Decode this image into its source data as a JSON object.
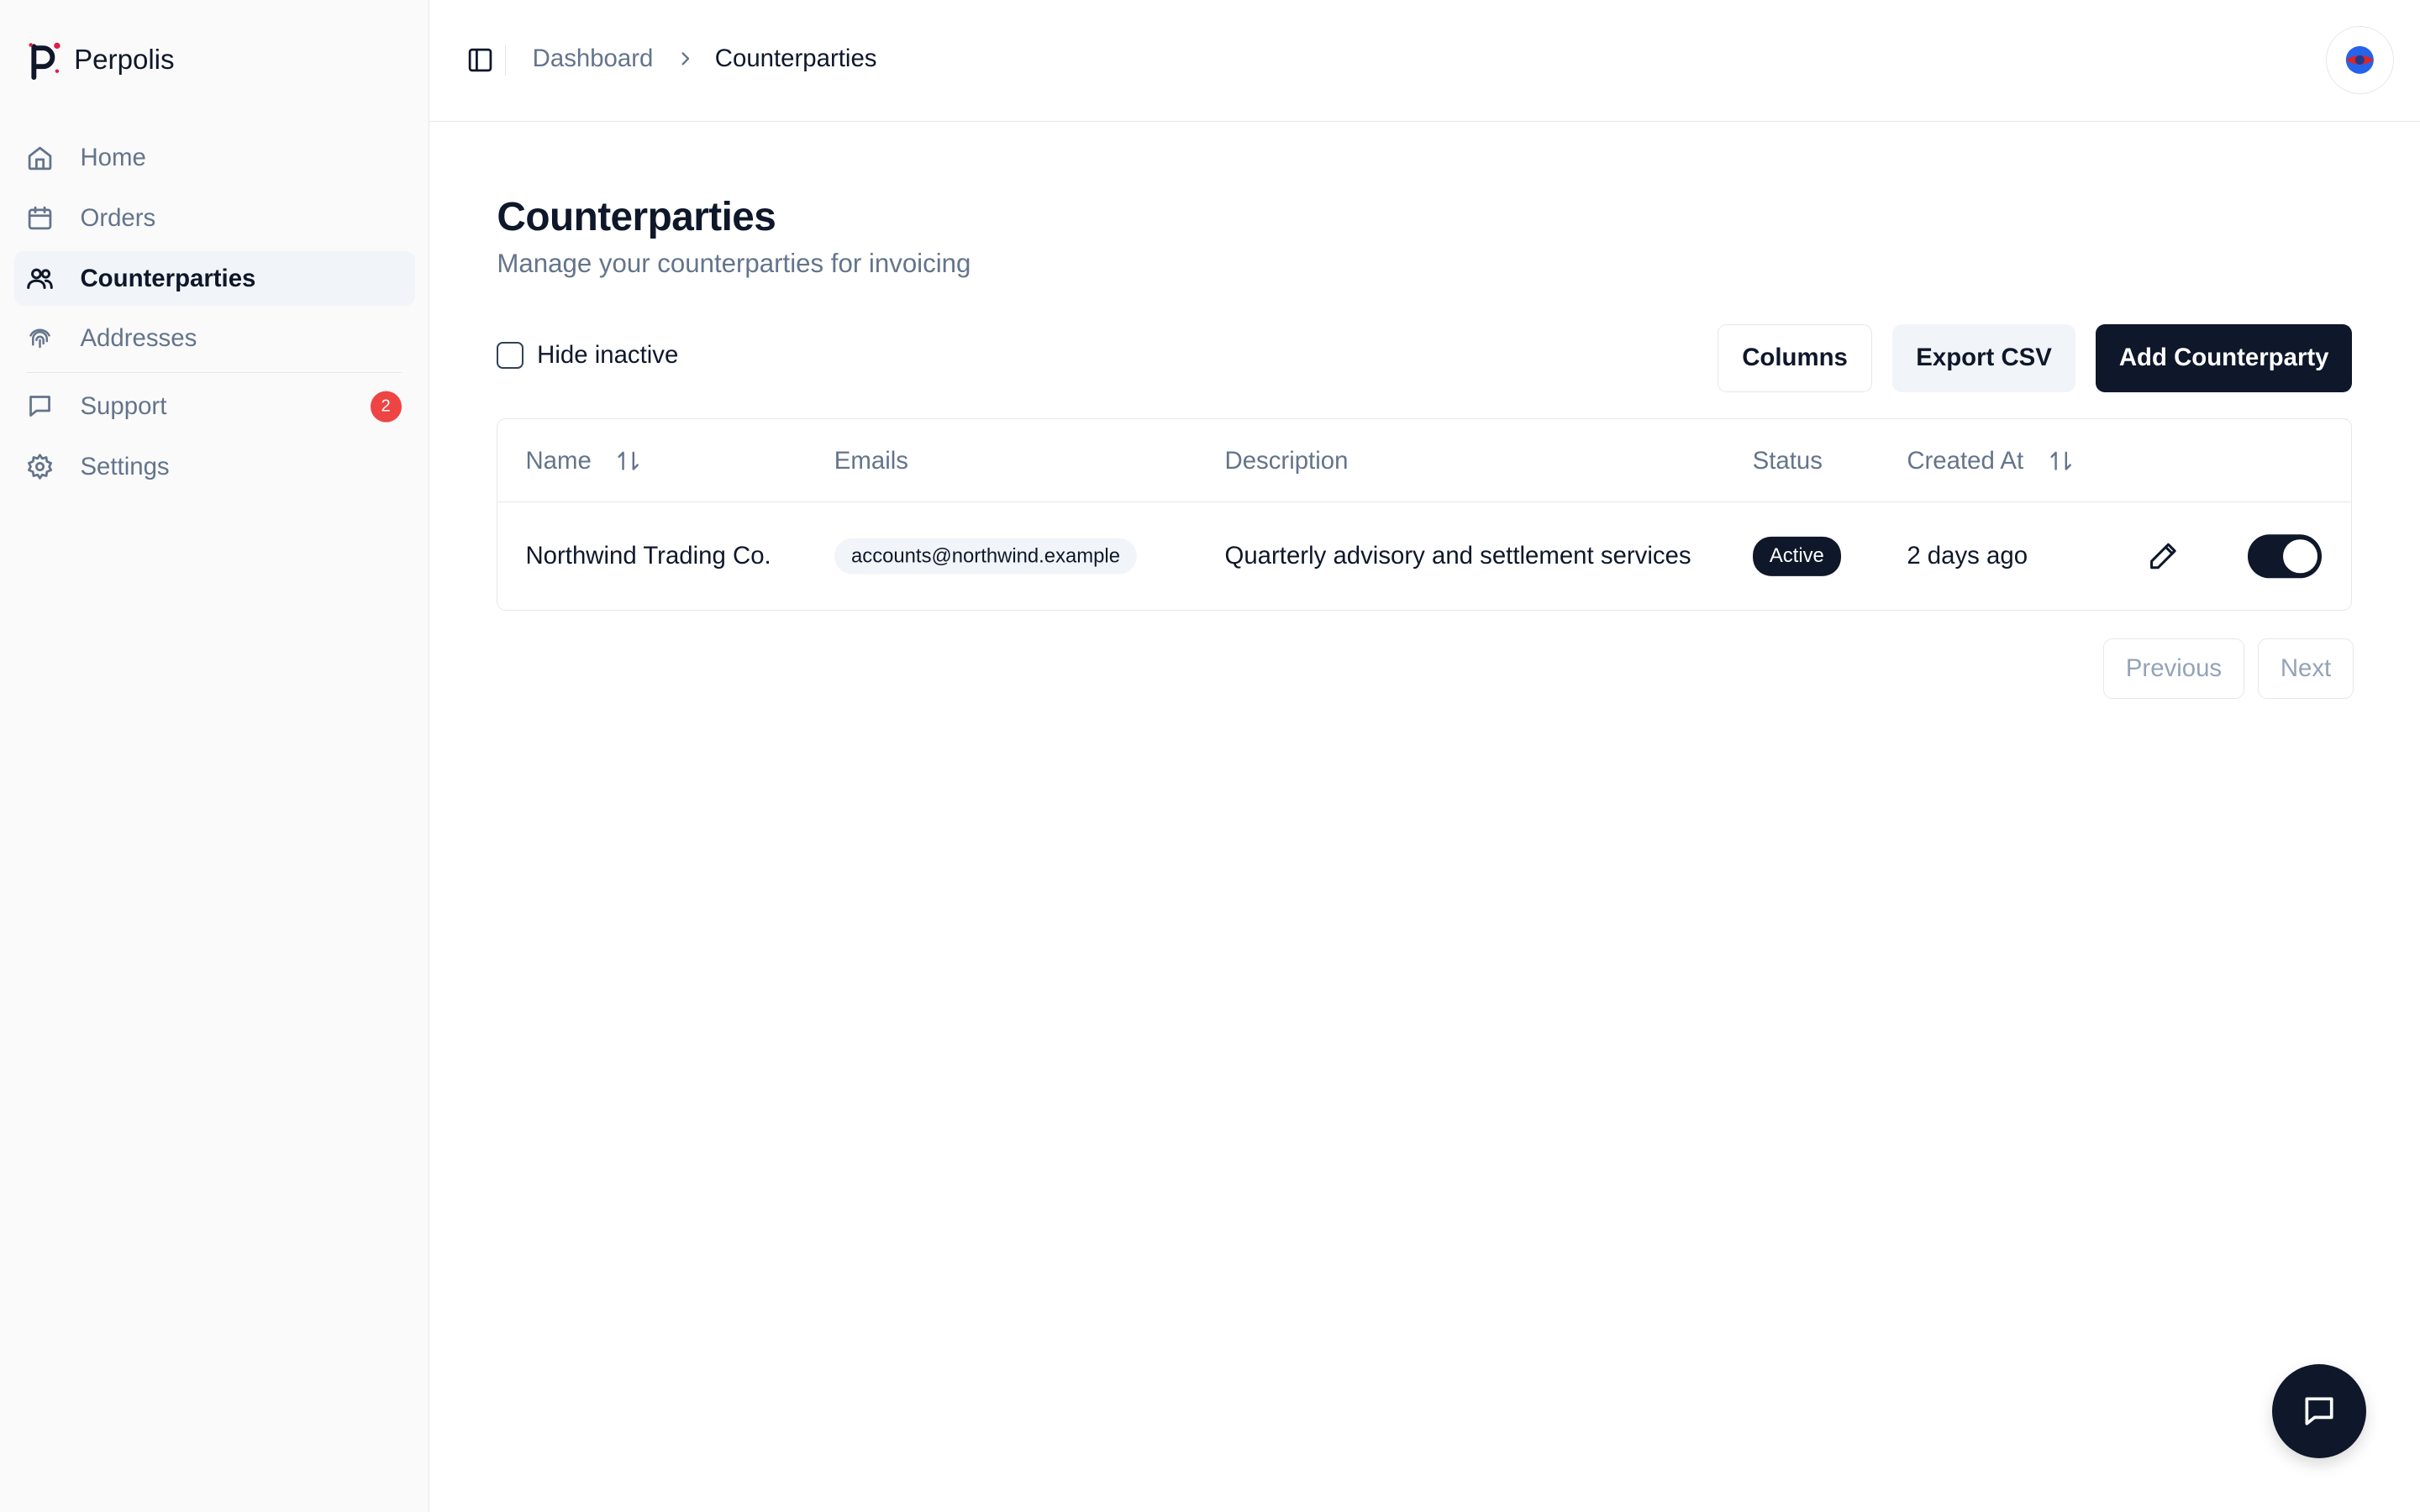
{
  "brand": {
    "name": "Perpolis",
    "accent": "#e11d48"
  },
  "sidebar": {
    "items": [
      {
        "label": "Home",
        "icon": "home-icon",
        "active": false
      },
      {
        "label": "Orders",
        "icon": "calendar-icon",
        "active": false
      },
      {
        "label": "Counterparties",
        "icon": "users-icon",
        "active": true
      },
      {
        "label": "Addresses",
        "icon": "fingerprint-icon",
        "active": false
      },
      {
        "label": "Support",
        "icon": "message-icon",
        "active": false,
        "badge": "2"
      },
      {
        "label": "Settings",
        "icon": "gear-icon",
        "active": false
      }
    ]
  },
  "header": {
    "breadcrumb": {
      "parent": "Dashboard",
      "current": "Counterparties"
    }
  },
  "page": {
    "title": "Counterparties",
    "subtitle": "Manage your counterparties for invoicing",
    "filter_label": "Hide inactive",
    "buttons": {
      "columns": "Columns",
      "export": "Export CSV",
      "add": "Add Counterparty"
    }
  },
  "table": {
    "columns": [
      "Name",
      "Emails",
      "Description",
      "Status",
      "Created At"
    ],
    "rows": [
      {
        "name": "Northwind Trading Co.",
        "email": "accounts@northwind.example",
        "description": "Quarterly advisory and settlement services",
        "status": "Active",
        "created": "2 days ago",
        "enabled": true
      }
    ]
  },
  "pagination": {
    "previous": "Previous",
    "next": "Next"
  }
}
